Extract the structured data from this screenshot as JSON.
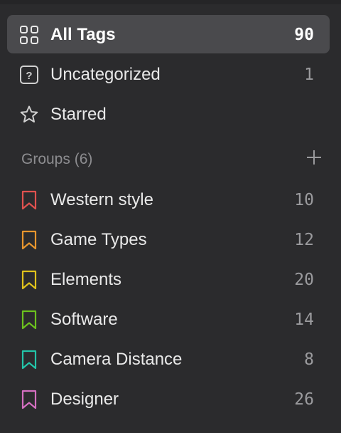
{
  "nav": {
    "all_tags": {
      "label": "All Tags",
      "count": "90"
    },
    "uncategorized": {
      "label": "Uncategorized",
      "count": "1"
    },
    "starred": {
      "label": "Starred"
    }
  },
  "groups": {
    "title": "Groups (6)",
    "items": [
      {
        "label": "Western style",
        "count": "10",
        "color": "#e0524f"
      },
      {
        "label": "Game Types",
        "count": "12",
        "color": "#e8962e"
      },
      {
        "label": "Elements",
        "count": "20",
        "color": "#e0c21c"
      },
      {
        "label": "Software",
        "count": "14",
        "color": "#6cc11e"
      },
      {
        "label": "Camera Distance",
        "count": "8",
        "color": "#23c4a8"
      },
      {
        "label": "Designer",
        "count": "26",
        "color": "#d46fc0"
      }
    ]
  },
  "icons": {
    "all_tags": "grid-icon",
    "uncategorized": "question-box-icon",
    "starred": "star-icon",
    "add_group": "plus-icon",
    "group": "bookmark-icon"
  }
}
